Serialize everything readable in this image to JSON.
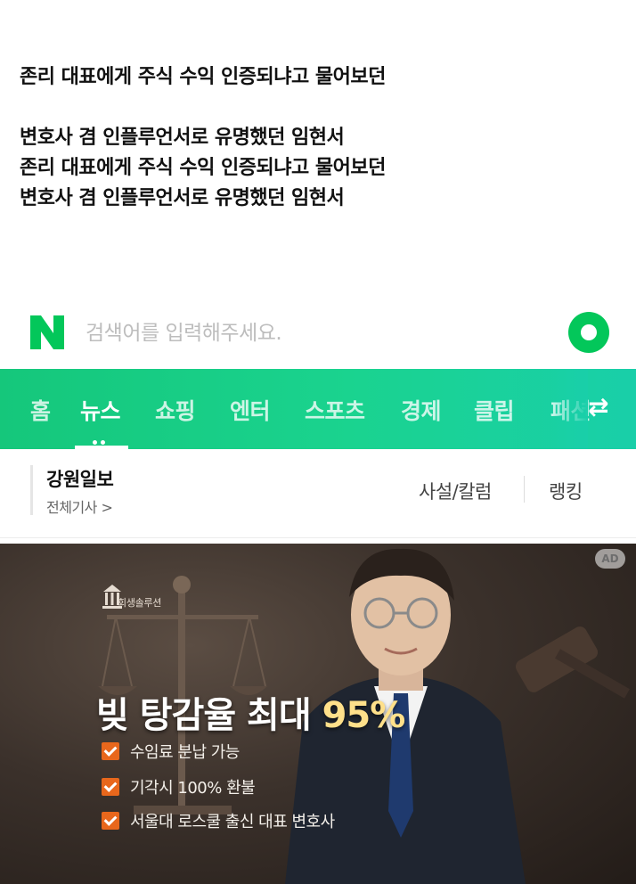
{
  "caption": {
    "lines": [
      "존리 대표에게 주식 수익 인증되냐고 물어보던",
      "변호사 겸 인플루언서로 유명했던 임현서",
      "존리 대표에게 주식 수익 인증되냐고 물어보던",
      "변호사 겸 인플루언서로 유명했던 임현서"
    ]
  },
  "search": {
    "logo_letter": "N",
    "placeholder": "검색어를 입력해주세요."
  },
  "nav": {
    "items": [
      "홈",
      "뉴스",
      "쇼핑",
      "엔터",
      "스포츠",
      "경제",
      "클립",
      "패션"
    ],
    "active": "뉴스",
    "swap_symbol": "⇄"
  },
  "press": {
    "name": "강원일보",
    "all_articles": "전체기사 >",
    "tabs": [
      "사설/칼럼",
      "랭킹"
    ]
  },
  "ad": {
    "badge": "AD",
    "logo_text": "회생솔루션",
    "headline_prefix": "빚 탕감율 최대 ",
    "headline_pct": "95%",
    "bullets": [
      "수임료 분납 가능",
      "기각시 100% 환불",
      "서울대 로스쿨 출신 대표 변호사"
    ]
  },
  "colors": {
    "naver_green": "#03c75a",
    "nav_gradient_start": "#15c77b",
    "nav_gradient_end": "#19cfa9",
    "ad_check_orange": "#e8671c"
  }
}
